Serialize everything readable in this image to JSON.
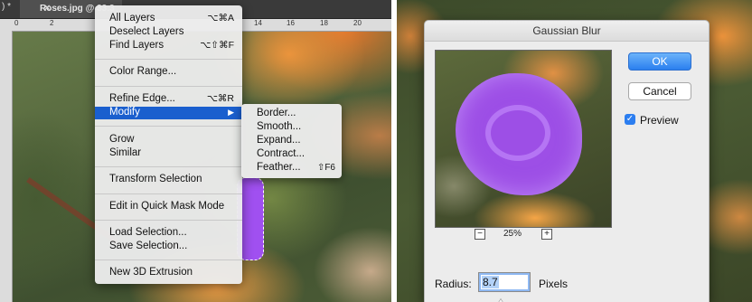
{
  "left": {
    "prev_tab_mark": ") *",
    "tab": {
      "close": "×",
      "title": "Roses.jpg @ 33.3"
    },
    "ruler_ticks": [
      "0",
      "2",
      "14",
      "16",
      "18",
      "20"
    ],
    "menu": {
      "items": [
        {
          "label": "All Layers",
          "shortcut": "⌥⌘A"
        },
        {
          "label": "Deselect Layers",
          "shortcut": ""
        },
        {
          "label": "Find Layers",
          "shortcut": "⌥⇧⌘F"
        },
        {
          "label": "Color Range...",
          "shortcut": ""
        },
        {
          "label": "Refine Edge...",
          "shortcut": "⌥⌘R"
        },
        {
          "label": "Modify",
          "shortcut": "▶"
        },
        {
          "label": "Grow",
          "shortcut": ""
        },
        {
          "label": "Similar",
          "shortcut": ""
        },
        {
          "label": "Transform Selection",
          "shortcut": ""
        },
        {
          "label": "Edit in Quick Mask Mode",
          "shortcut": ""
        },
        {
          "label": "Load Selection...",
          "shortcut": ""
        },
        {
          "label": "Save Selection...",
          "shortcut": ""
        },
        {
          "label": "New 3D Extrusion",
          "shortcut": ""
        }
      ]
    },
    "submenu": {
      "items": [
        {
          "label": "Border...",
          "shortcut": ""
        },
        {
          "label": "Smooth...",
          "shortcut": ""
        },
        {
          "label": "Expand...",
          "shortcut": ""
        },
        {
          "label": "Contract...",
          "shortcut": ""
        },
        {
          "label": "Feather...",
          "shortcut": "⇧F6"
        }
      ]
    }
  },
  "dialog": {
    "title": "Gaussian Blur",
    "ok": "OK",
    "cancel": "Cancel",
    "preview_label": "Preview",
    "preview_checked": true,
    "zoom_minus": "−",
    "zoom_level": "25%",
    "zoom_plus": "+",
    "radius_label": "Radius:",
    "radius_value": "8.7",
    "radius_units": "Pixels",
    "check_mark": "✓",
    "accent_color": "#2c7ef0"
  }
}
